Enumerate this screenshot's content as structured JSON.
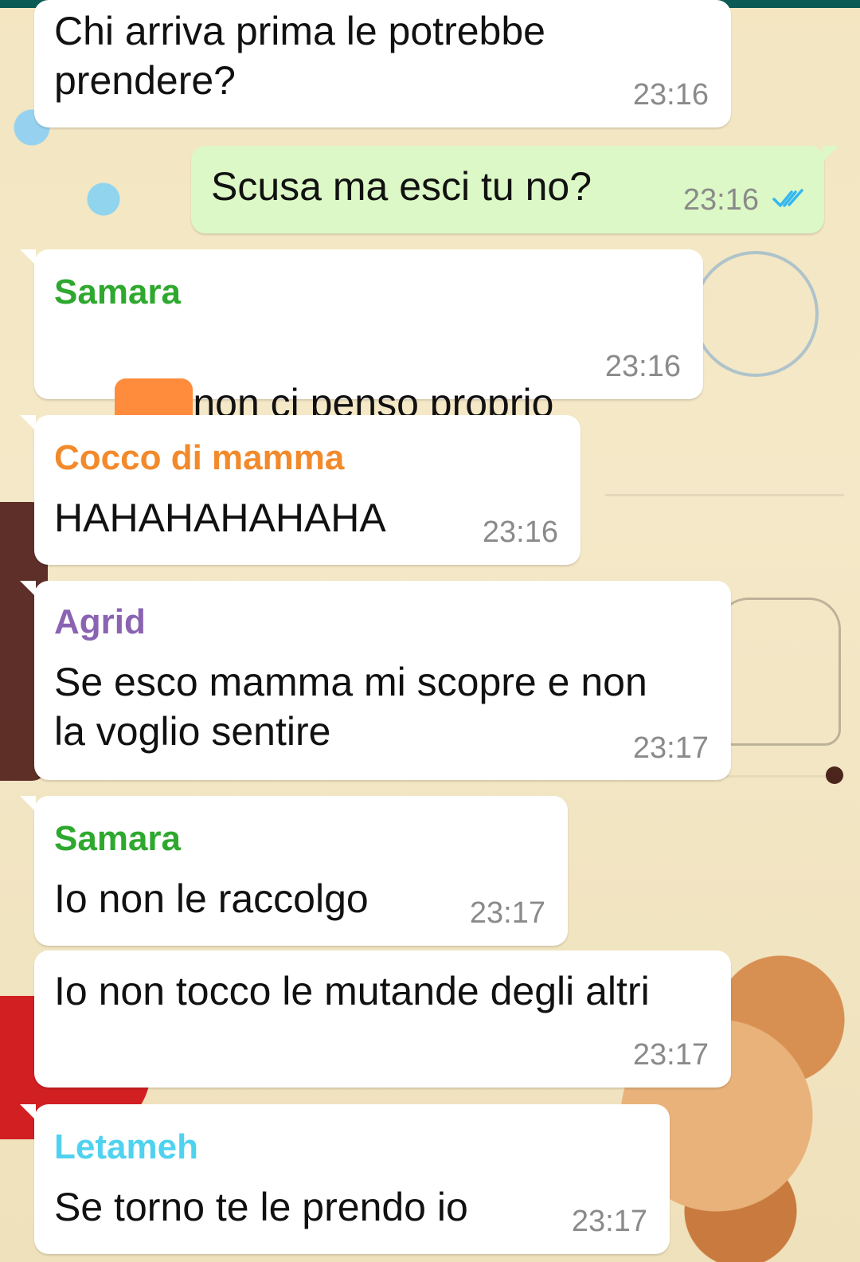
{
  "colors": {
    "top_bar": "#0b5a53",
    "incoming_bubble": "#ffffff",
    "outgoing_bubble": "#dcf8c6",
    "time_text": "#8a8a8a",
    "read_ticks": "#34b7f1",
    "redaction": "#ff8b3d",
    "sender_samara": "#2ea82e",
    "sender_cocco": "#f28a2b",
    "sender_agrid": "#8a63b3",
    "sender_letameh": "#4fd2ef"
  },
  "messages": [
    {
      "id": "m1",
      "text": "Chi arriva prima le potrebbe\nprendere?",
      "time": "23:16"
    },
    {
      "id": "m2",
      "text": "Scusa ma esci tu no?",
      "time": "23:16",
      "status_icon": "double-check-icon"
    },
    {
      "id": "m3",
      "sender": "Samara",
      "text": "non ci penso proprio",
      "time": "23:16",
      "redaction_icon": "redaction-marker"
    },
    {
      "id": "m4",
      "sender": "Cocco di mamma",
      "text": "HAHAHAHAHAHA",
      "time": "23:16"
    },
    {
      "id": "m5",
      "sender": "Agrid",
      "text": "Se esco mamma mi scopre e non\nla voglio sentire",
      "time": "23:17"
    },
    {
      "id": "m6",
      "sender": "Samara",
      "text": "Io non le raccolgo",
      "time": "23:17"
    },
    {
      "id": "m7",
      "text": "Io non tocco le mutande degli altri",
      "time": "23:17"
    },
    {
      "id": "m8",
      "sender": "Letameh",
      "text": "Se torno te le prendo io",
      "time": "23:17"
    }
  ]
}
